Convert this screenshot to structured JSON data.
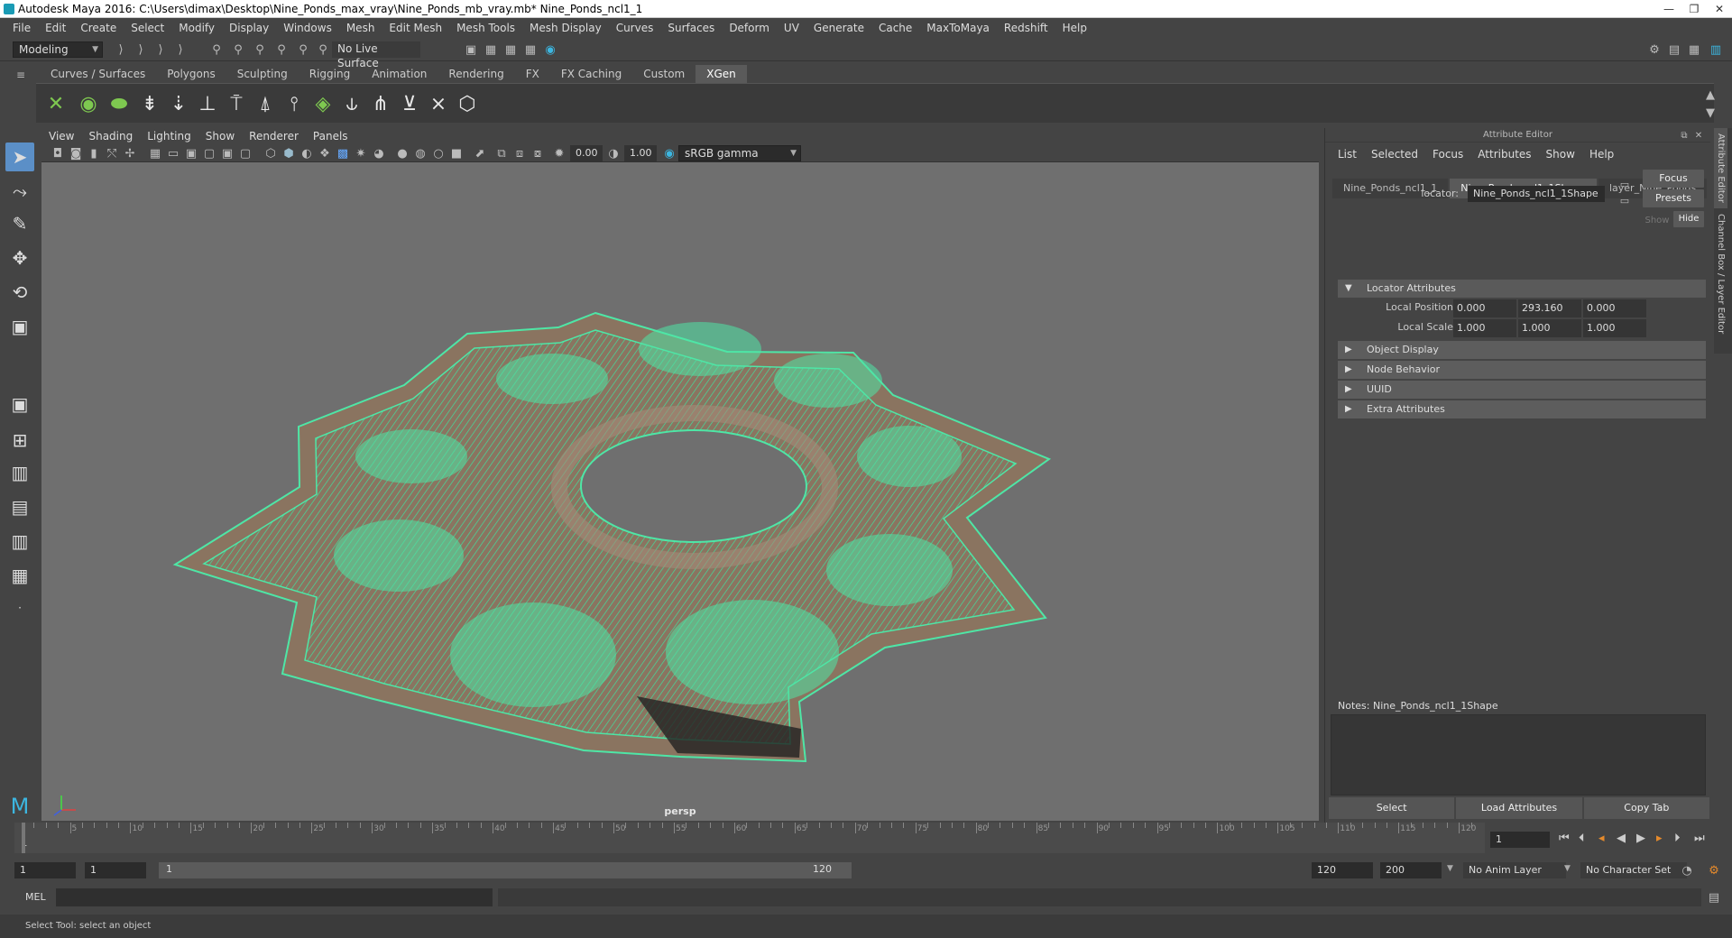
{
  "window": {
    "title": "Autodesk Maya 2016: C:\\Users\\dimax\\Desktop\\Nine_Ponds_max_vray\\Nine_Ponds_mb_vray.mb*    Nine_Ponds_ncl1_1",
    "controls": [
      "—",
      "❐",
      "✕"
    ]
  },
  "menubar": [
    "File",
    "Edit",
    "Create",
    "Select",
    "Modify",
    "Display",
    "Windows",
    "Mesh",
    "Edit Mesh",
    "Mesh Tools",
    "Mesh Display",
    "Curves",
    "Surfaces",
    "Deform",
    "UV",
    "Generate",
    "Cache",
    "MaxToMaya",
    "Redshift",
    "Help"
  ],
  "status": {
    "mode": "Modeling",
    "live_surface": "No Live Surface"
  },
  "shelf": {
    "tabs": [
      "Curves / Surfaces",
      "Polygons",
      "Sculpting",
      "Rigging",
      "Animation",
      "Rendering",
      "FX",
      "FX Caching",
      "Custom",
      "XGen"
    ],
    "active_tab": "XGen"
  },
  "viewport": {
    "menu": [
      "View",
      "Shading",
      "Lighting",
      "Show",
      "Renderer",
      "Panels"
    ],
    "exposure": "0.00",
    "gamma": "1.00",
    "color_space": "sRGB gamma",
    "camera_label": "persp"
  },
  "attribute_editor": {
    "title": "Attribute Editor",
    "menu": [
      "List",
      "Selected",
      "Focus",
      "Attributes",
      "Show",
      "Help"
    ],
    "tabs": [
      "Nine_Ponds_ncl1_1",
      "Nine_Ponds_ncl1_1Shape",
      "layer_Nine_Ponds"
    ],
    "active_tab": "Nine_Ponds_ncl1_1Shape",
    "focus_btn": "Focus",
    "presets_btn": "Presets",
    "show_label": "Show",
    "hide_btn": "Hide",
    "node_label": "locator:",
    "node_value": "Nine_Ponds_ncl1_1Shape",
    "sections": {
      "locator": "Locator Attributes",
      "object_display": "Object Display",
      "node_behavior": "Node Behavior",
      "uuid": "UUID",
      "extra": "Extra Attributes"
    },
    "local_position_label": "Local Position",
    "local_position": [
      "0.000",
      "293.160",
      "0.000"
    ],
    "local_scale_label": "Local Scale",
    "local_scale": [
      "1.000",
      "1.000",
      "1.000"
    ],
    "notes_label": "Notes:  Nine_Ponds_ncl1_1Shape",
    "bottom": {
      "select": "Select",
      "load": "Load Attributes",
      "copy": "Copy Tab"
    }
  },
  "side_tabs": [
    "Attribute Editor",
    "Channel Box / Layer Editor"
  ],
  "timeline": {
    "labels": [
      "5",
      "10",
      "15",
      "20",
      "25",
      "30",
      "35",
      "40",
      "45",
      "50",
      "55",
      "60",
      "65",
      "70",
      "75",
      "80",
      "85",
      "90",
      "95",
      "100",
      "105",
      "110",
      "115",
      "120"
    ],
    "start_label": "1",
    "current_frame": "1"
  },
  "range": {
    "start": "1",
    "start2": "1",
    "slider_start": "1",
    "slider_end": "120",
    "end": "120",
    "end2": "200",
    "anim_layer": "No Anim Layer",
    "char_set": "No Character Set"
  },
  "cmd": {
    "label": "MEL"
  },
  "help": {
    "text": "Select Tool: select an object"
  }
}
